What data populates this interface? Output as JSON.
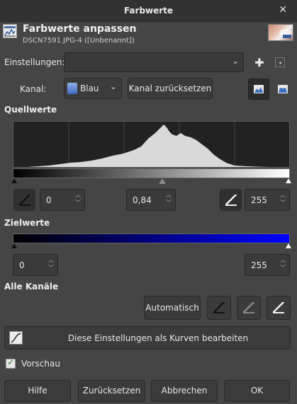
{
  "window": {
    "title": "Farbwerte",
    "close_glyph": "✕"
  },
  "header": {
    "title": "Farbwerte anpassen",
    "subtitle": "DSCN7591.JPG-4 ([Unbenannt])"
  },
  "settings": {
    "label": "Einstellungen:",
    "value": ""
  },
  "channel": {
    "label": "Kanal:",
    "value": "Blau",
    "reset_label": "Kanal zurücksetzen"
  },
  "source": {
    "title": "Quellwerte",
    "low": "0",
    "gamma": "0,84",
    "high": "255"
  },
  "target": {
    "title": "Zielwerte",
    "low": "0",
    "high": "255"
  },
  "all_channels": {
    "title": "Alle Kanäle",
    "auto_label": "Automatisch"
  },
  "curves_button": "Diese Einstellungen als Kurven bearbeiten",
  "preview": {
    "label": "Vorschau",
    "checked": true
  },
  "footer": {
    "help": "Hilfe",
    "reset": "Zurücksetzen",
    "cancel": "Abbrechen",
    "ok": "OK"
  },
  "colors": {
    "accent_blue": "#0000ff",
    "histogram": "#d9d9d9",
    "histogram_bg": "#222222"
  },
  "icons": [
    "levels-icon",
    "image-thumbnail",
    "add-icon",
    "menu-icon",
    "channel-icon",
    "linear-histogram-icon",
    "log-histogram-icon",
    "eyedropper-icon",
    "curves-icon",
    "checkmark-icon"
  ]
}
